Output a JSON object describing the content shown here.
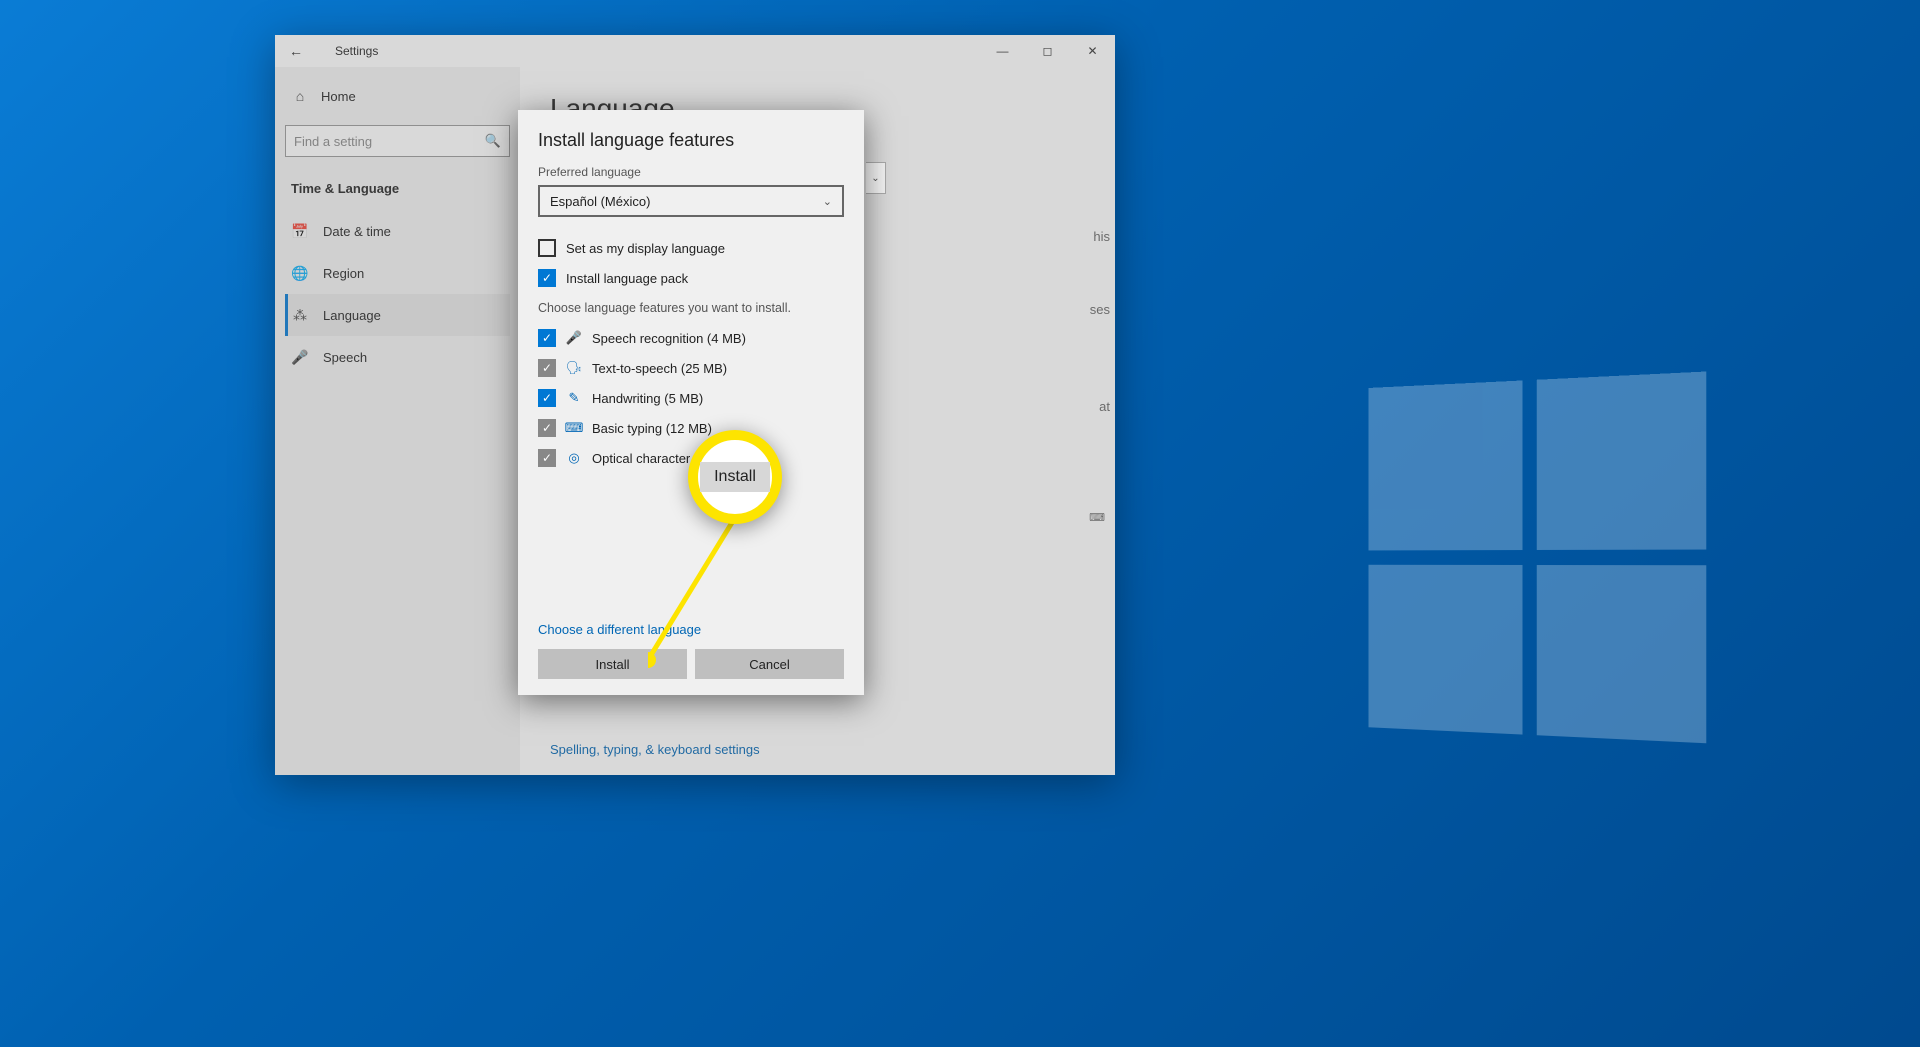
{
  "window": {
    "app_title": "Settings",
    "page_title": "Language"
  },
  "sidebar": {
    "home": "Home",
    "search_placeholder": "Find a setting",
    "section": "Time & Language",
    "items": [
      {
        "label": "Date & time"
      },
      {
        "label": "Region"
      },
      {
        "label": "Language"
      },
      {
        "label": "Speech"
      }
    ]
  },
  "main": {
    "peek1": "his",
    "peek2": "ses",
    "peek3": "at",
    "link": "Spelling, typing, & keyboard settings"
  },
  "dialog": {
    "title": "Install language features",
    "pref_label": "Preferred language",
    "pref_value": "Español (México)",
    "opt_display": "Set as my display language",
    "opt_pack": "Install language pack",
    "hint": "Choose language features you want to install.",
    "feat_speech": "Speech recognition (4 MB)",
    "feat_tts": "Text-to-speech (25 MB)",
    "feat_hand": "Handwriting (5 MB)",
    "feat_typing": "Basic typing (12 MB)",
    "feat_ocr": "Optical character recognition",
    "diff_lang": "Choose a different language",
    "btn_install": "Install",
    "btn_cancel": "Cancel"
  },
  "callout": {
    "label": "Install"
  }
}
